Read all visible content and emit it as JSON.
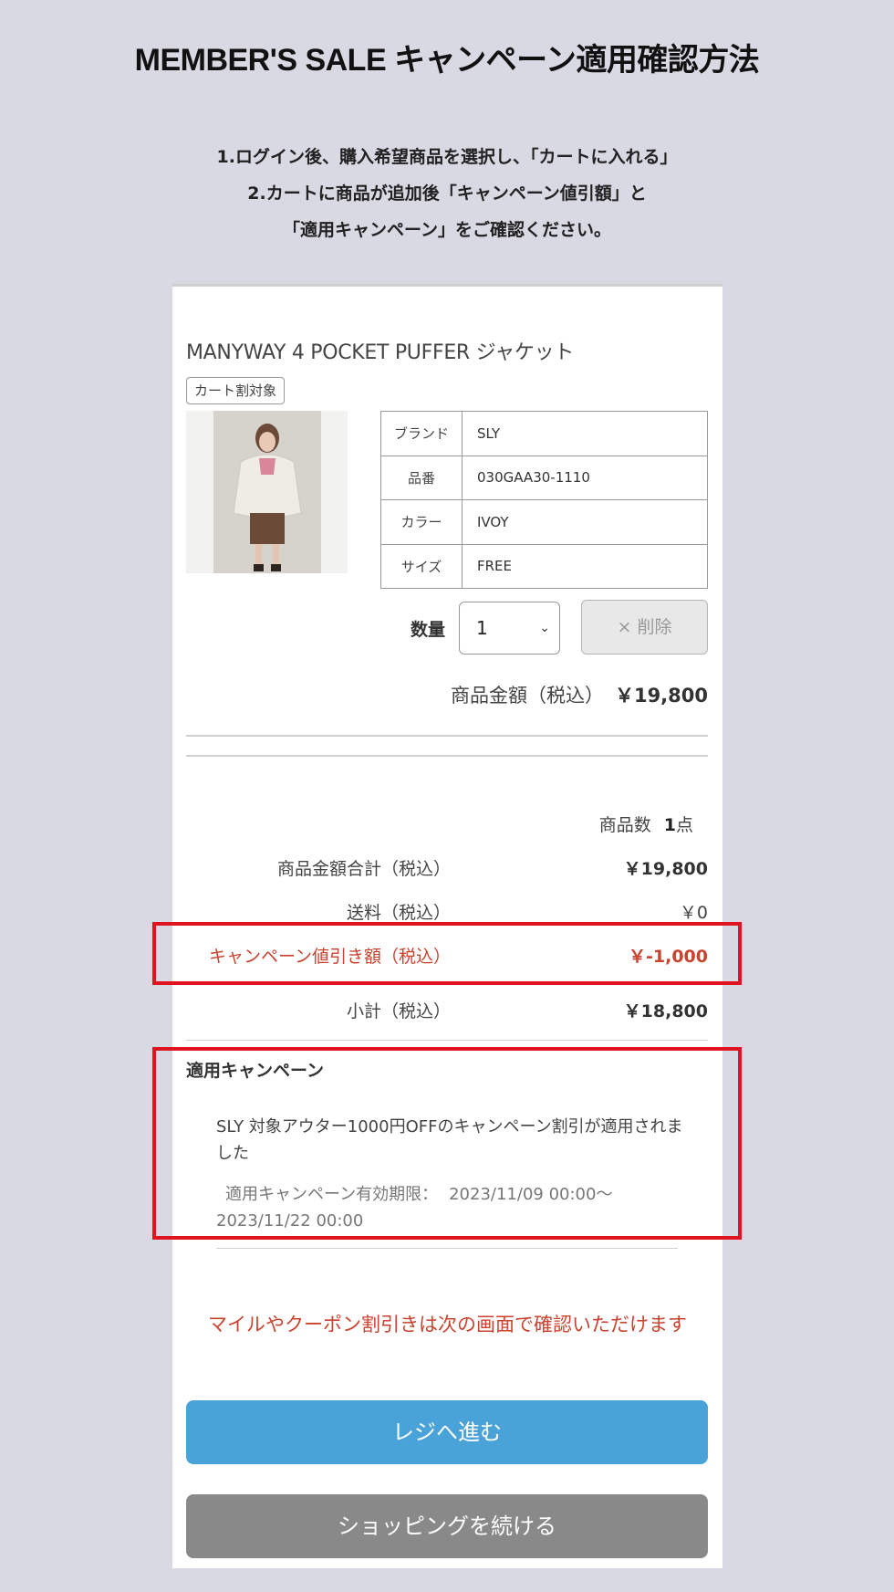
{
  "page": {
    "title": "MEMBER'S SALE キャンペーン適用確認方法",
    "instructions": [
      "1.ログイン後、購入希望商品を選択し、「カートに入れる」",
      "2.カートに商品が追加後「キャンペーン値引額」と",
      "「適用キャンペーン」をご確認ください。"
    ]
  },
  "cart": {
    "product_name": "MANYWAY 4 POCKET PUFFER ジャケット",
    "tag": "カート割対象",
    "specs": [
      {
        "key": "ブランド",
        "value": "SLY"
      },
      {
        "key": "品番",
        "value": "030GAA30-1110"
      },
      {
        "key": "カラー",
        "value": "IVOY"
      },
      {
        "key": "サイズ",
        "value": "FREE"
      }
    ],
    "quantity_label": "数量",
    "quantity_value": "1",
    "delete_label": "× 削除",
    "item_price_label": "商品金額（税込）",
    "item_price": "￥19,800"
  },
  "summary": {
    "count_label": "商品数",
    "count_value": "1",
    "count_unit": "点",
    "subtotal_items_label": "商品金額合計（税込）",
    "subtotal_items_value": "￥19,800",
    "shipping_label": "送料（税込）",
    "shipping_value": "￥0",
    "discount_label": "キャンペーン値引き額（税込）",
    "discount_value": "￥-1,000",
    "subtotal_label": "小計（税込）",
    "subtotal_value": "￥18,800"
  },
  "campaign": {
    "heading": "適用キャンペーン",
    "text": "SLY 対象アウター1000円OFFのキャンペーン割引が適用されました",
    "period_label": "適用キャンペーン有効期限：",
    "period_start": "2023/11/09 00:00〜",
    "period_end": "2023/11/22 00:00"
  },
  "footer": {
    "note": "マイルやクーポン割引きは次の画面で確認いただけます",
    "checkout_button": "レジへ進む",
    "continue_button": "ショッピングを続ける"
  },
  "colors": {
    "background": "#d9d9e3",
    "highlight": "#e0141e",
    "discount_red": "#c9432f",
    "checkout_blue": "#4aa3d8",
    "continue_gray": "#898989"
  }
}
